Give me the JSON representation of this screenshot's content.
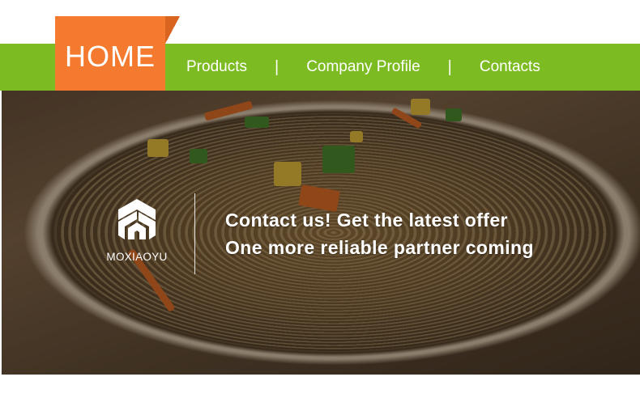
{
  "nav": {
    "home_label": "HOME",
    "links": [
      {
        "label": "Products"
      },
      {
        "label": "Company Profile"
      },
      {
        "label": "Contacts"
      }
    ],
    "separator": "|"
  },
  "brand": {
    "name": "MOXIAOYU",
    "logo_icon": "moxiaoyu-logo-icon"
  },
  "promo": {
    "line1": "Contact us! Get the latest offer",
    "line2": "One more reliable partner coming"
  },
  "colors": {
    "nav_green": "#7dbb23",
    "home_orange": "#f47a2f",
    "text_white": "#ffffff"
  }
}
